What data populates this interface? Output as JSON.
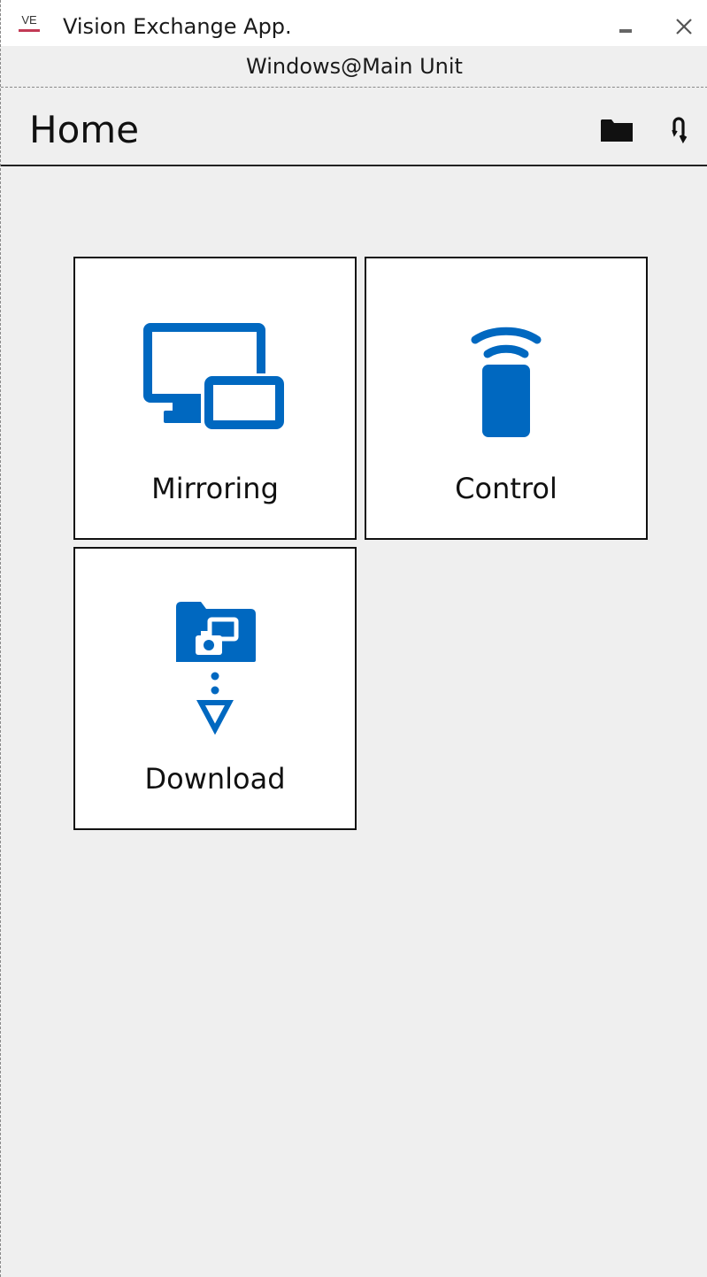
{
  "window": {
    "logo_text": "VE",
    "title": "Vision Exchange App.",
    "subtitle": "Windows@Main Unit"
  },
  "header": {
    "title": "Home"
  },
  "tiles": [
    {
      "label": "Mirroring",
      "icon": "mirroring-icon"
    },
    {
      "label": "Control",
      "icon": "remote-control-icon"
    },
    {
      "label": "Download",
      "icon": "download-icon"
    }
  ],
  "colors": {
    "accent": "#0068c0",
    "logo_underline": "#c23a55",
    "background": "#efefef"
  }
}
